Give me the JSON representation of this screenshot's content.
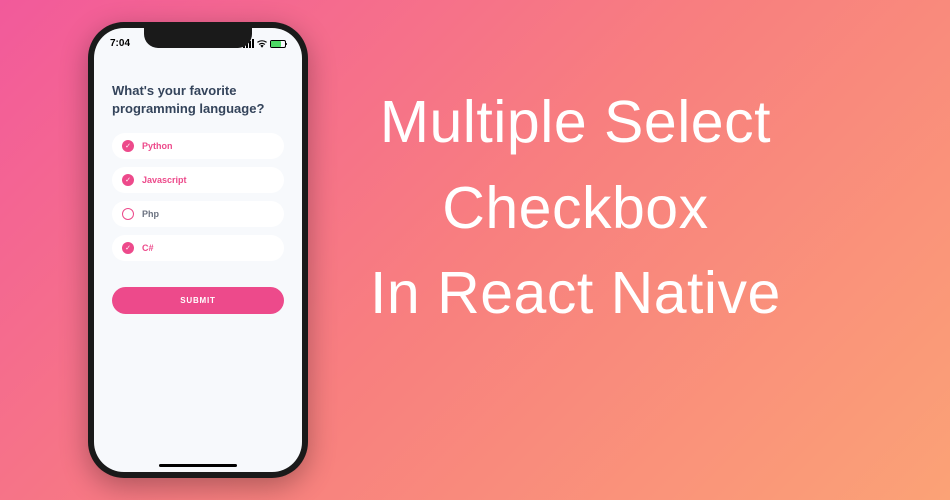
{
  "headline": {
    "line1": "Multiple Select",
    "line2": "Checkbox",
    "line3": "In React Native"
  },
  "phone": {
    "status": {
      "time": "7:04"
    },
    "question": "What's your favorite programming language?",
    "options": [
      {
        "label": "Python",
        "checked": true
      },
      {
        "label": "Javascript",
        "checked": true
      },
      {
        "label": "Php",
        "checked": false
      },
      {
        "label": "C#",
        "checked": true
      }
    ],
    "submit_label": "SUBMIT"
  }
}
